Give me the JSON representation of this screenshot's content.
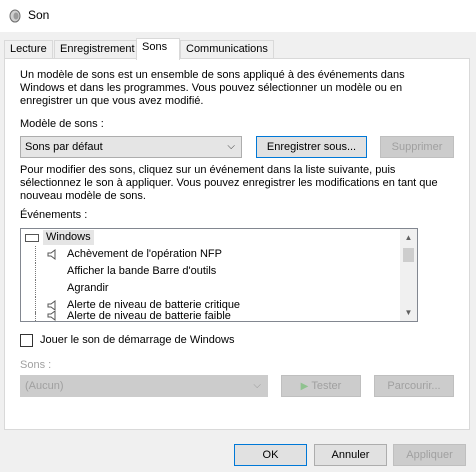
{
  "window": {
    "title": "Son",
    "icon": "speaker-icon"
  },
  "tabs": [
    {
      "label": "Lecture",
      "active": false
    },
    {
      "label": "Enregistrement",
      "active": false
    },
    {
      "label": "Sons",
      "active": true
    },
    {
      "label": "Communications",
      "active": false
    }
  ],
  "sounds_tab": {
    "intro_text": "Un modèle de sons est un ensemble de sons appliqué à des événements dans Windows et dans les programmes. Vous pouvez sélectionner un modèle ou en enregistrer un que vous avez modifié.",
    "scheme_label": "Modèle de sons :",
    "scheme_value": "Sons par défaut",
    "save_as_label": "Enregistrer sous...",
    "delete_label": "Supprimer",
    "modify_text": "Pour modifier des sons, cliquez sur un événement dans la liste suivante, puis sélectionnez le son à appliquer. Vous pouvez enregistrer les modifications en tant que nouveau modèle de sons.",
    "events_label": "Événements :",
    "events": [
      {
        "label": "Windows",
        "type": "group",
        "has_sound": false
      },
      {
        "label": "Achèvement de l'opération NFP",
        "type": "item",
        "has_sound": true
      },
      {
        "label": "Afficher la bande Barre d'outils",
        "type": "item",
        "has_sound": false
      },
      {
        "label": "Agrandir",
        "type": "item",
        "has_sound": false
      },
      {
        "label": "Alerte de niveau de batterie critique",
        "type": "item",
        "has_sound": true
      },
      {
        "label": "Alerte de niveau de batterie faible",
        "type": "item",
        "has_sound": true
      }
    ],
    "startup_sound_label": "Jouer le son de démarrage de Windows",
    "startup_sound_checked": false,
    "sounds_label": "Sons :",
    "sounds_value": "(Aucun)",
    "test_label": "Tester",
    "browse_label": "Parcourir..."
  },
  "footer": {
    "ok_label": "OK",
    "cancel_label": "Annuler",
    "apply_label": "Appliquer"
  },
  "colors": {
    "focus_border": "#0078d7",
    "disabled_text": "#a0a0a0",
    "group_highlight": "#e5e5e5",
    "play_icon_disabled": "#8fc28f"
  }
}
